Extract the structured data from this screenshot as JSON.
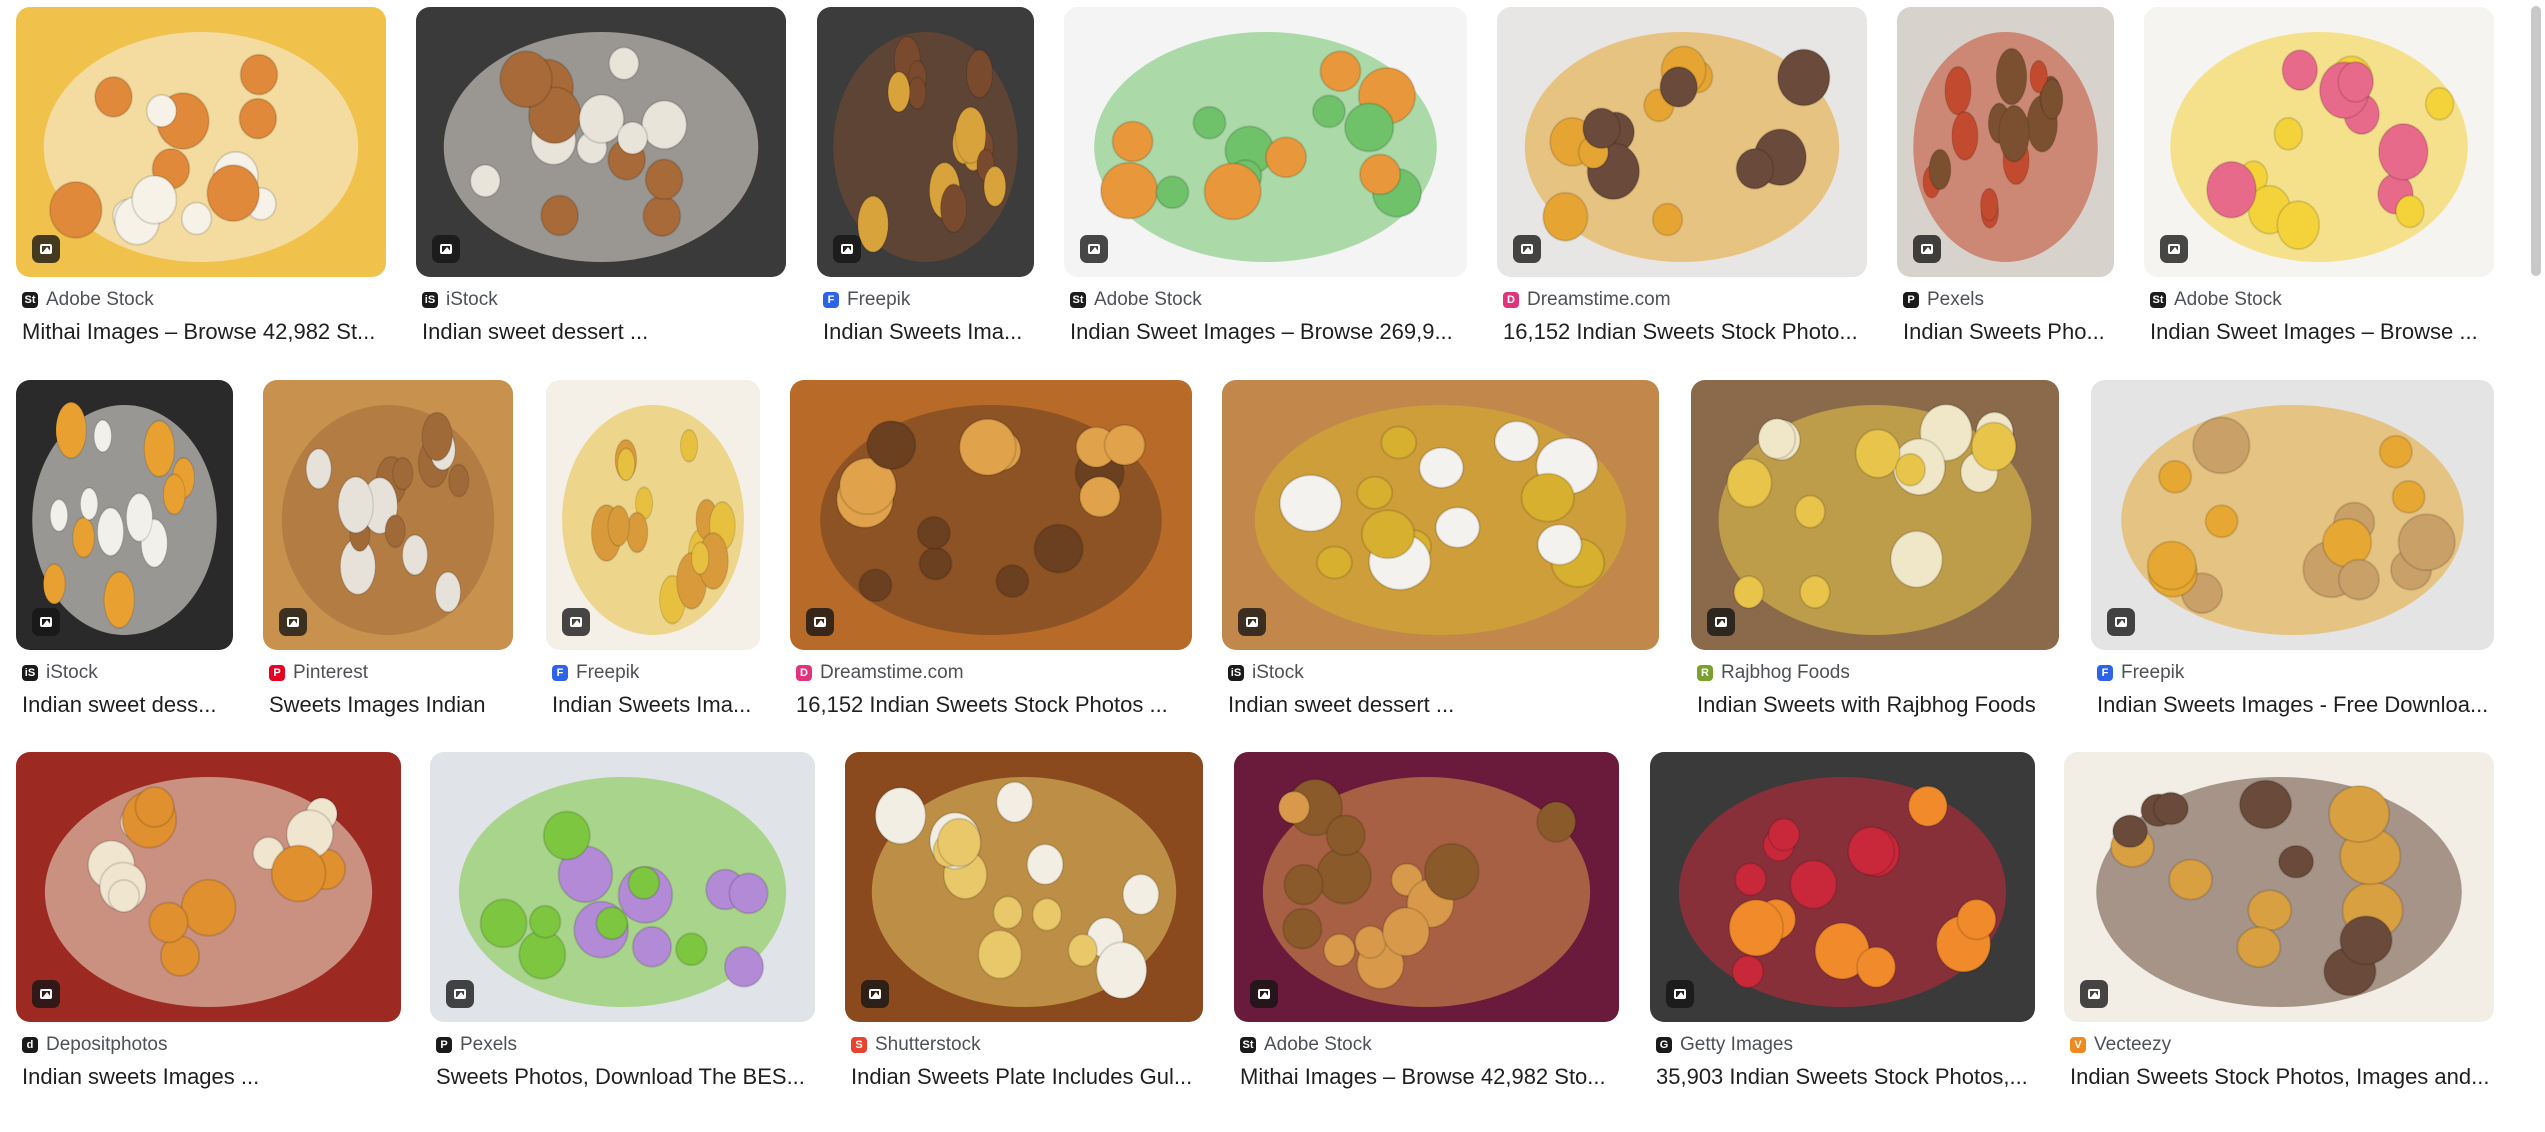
{
  "results": [
    {
      "source": "Adobe Stock",
      "title": "Mithai Images – Browse 42,982 St...",
      "fav": "St",
      "fav_color": "#1a1a1a",
      "img_colors": [
        "#f0c14b",
        "#e0893a",
        "#f7f2e8"
      ]
    },
    {
      "source": "iStock",
      "title": "Indian sweet dessert ...",
      "fav": "iS",
      "fav_color": "#1a1a1a",
      "img_colors": [
        "#3a3a3a",
        "#a86a38",
        "#e9e4da"
      ]
    },
    {
      "source": "Freepik",
      "title": "Indian Sweets Ima...",
      "fav": "F",
      "fav_color": "#2e63e8",
      "img_colors": [
        "#3c3c3c",
        "#d9a33c",
        "#7a4a2e"
      ]
    },
    {
      "source": "Adobe Stock",
      "title": "Indian Sweet Images – Browse 269,9...",
      "fav": "St",
      "fav_color": "#1a1a1a",
      "img_colors": [
        "#f4f4f4",
        "#e8983a",
        "#6fc26a"
      ]
    },
    {
      "source": "Dreamstime.com",
      "title": "16,152 Indian Sweets Stock Photo...",
      "fav": "D",
      "fav_color": "#e0337b",
      "img_colors": [
        "#e8e6e4",
        "#6a4a3a",
        "#e6a532"
      ]
    },
    {
      "source": "Pexels",
      "title": "Indian Sweets Pho...",
      "fav": "P",
      "fav_color": "#1a1a1a",
      "img_colors": [
        "#d8d2cc",
        "#7a5030",
        "#c24a2e"
      ]
    },
    {
      "source": "Adobe Stock",
      "title": "Indian Sweet Images – Browse ...",
      "fav": "St",
      "fav_color": "#1a1a1a",
      "img_colors": [
        "#f6f4f0",
        "#e86a8a",
        "#f4d23a"
      ]
    },
    {
      "source": "iStock",
      "title": "Indian sweet dess...",
      "fav": "iS",
      "fav_color": "#1a1a1a",
      "img_colors": [
        "#2a2a2a",
        "#e8a030",
        "#f2f0ea"
      ]
    },
    {
      "source": "Pinterest",
      "title": "Sweets Images Indian",
      "fav": "P",
      "fav_color": "#e60023",
      "img_colors": [
        "#c8924e",
        "#e6e2da",
        "#a06a38"
      ]
    },
    {
      "source": "Freepik",
      "title": "Indian Sweets Ima...",
      "fav": "F",
      "fav_color": "#2e63e8",
      "img_colors": [
        "#f4f0e8",
        "#d89a3a",
        "#e8c040"
      ]
    },
    {
      "source": "Dreamstime.com",
      "title": "16,152 Indian Sweets Stock Photos ...",
      "fav": "D",
      "fav_color": "#e0337b",
      "img_colors": [
        "#b86a28",
        "#e0a24a",
        "#6a4020"
      ]
    },
    {
      "source": "iStock",
      "title": "Indian sweet dessert ...",
      "fav": "iS",
      "fav_color": "#1a1a1a",
      "img_colors": [
        "#c2874a",
        "#f4f2ee",
        "#d8b030"
      ]
    },
    {
      "source": "Rajbhog Foods",
      "title": "Indian Sweets with Rajbhog Foods",
      "fav": "R",
      "fav_color": "#7aa02e",
      "img_colors": [
        "#8a6a4a",
        "#f0e6c8",
        "#e8c44a"
      ]
    },
    {
      "source": "Freepik",
      "title": "Indian Sweets Images - Free Downloa...",
      "fav": "F",
      "fav_color": "#2e63e8",
      "img_colors": [
        "#e4e4e4",
        "#c8a068",
        "#e6a832"
      ]
    },
    {
      "source": "Depositphotos",
      "title": "Indian sweets Images ...",
      "fav": "d",
      "fav_color": "#1a1a1a",
      "img_colors": [
        "#9c2a22",
        "#e0902e",
        "#f0e6d0"
      ]
    },
    {
      "source": "Pexels",
      "title": "Sweets Photos, Download The BES...",
      "fav": "P",
      "fav_color": "#1a1a1a",
      "img_colors": [
        "#e0e4e8",
        "#b28ad6",
        "#7cc640"
      ]
    },
    {
      "source": "Shutterstock",
      "title": "Indian Sweets Plate Includes Gul...",
      "fav": "S",
      "fav_color": "#e8432e",
      "img_colors": [
        "#8a4a1e",
        "#f2eee4",
        "#e8c868"
      ]
    },
    {
      "source": "Adobe Stock",
      "title": "Mithai Images – Browse 42,982 Sto...",
      "fav": "St",
      "fav_color": "#1a1a1a",
      "img_colors": [
        "#6a1a3a",
        "#8a5a2a",
        "#d89a4a"
      ]
    },
    {
      "source": "Getty Images",
      "title": "35,903 Indian Sweets Stock Photos,...",
      "fav": "G",
      "fav_color": "#1a1a1a",
      "img_colors": [
        "#3a3a3a",
        "#f08a2a",
        "#c8283a"
      ]
    },
    {
      "source": "Vecteezy",
      "title": "Indian Sweets Stock Photos, Images and...",
      "fav": "V",
      "fav_color": "#f08a1e",
      "img_colors": [
        "#f2eee6",
        "#d8a040",
        "#6a4a3a"
      ]
    }
  ]
}
